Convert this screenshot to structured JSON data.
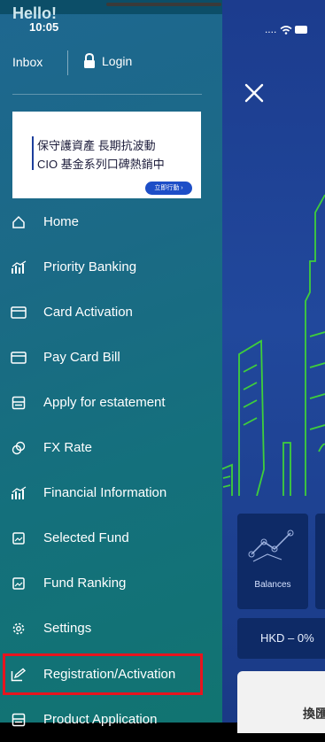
{
  "status": {
    "time": "10:05",
    "signal": "....",
    "wifi_icon": "wifi-icon",
    "battery_icon": "battery-icon"
  },
  "drawer": {
    "greeting": "Hello!",
    "inbox_label": "Inbox",
    "login_label": "Login",
    "ad": {
      "line1": "保守護資產 長期抗波動",
      "line2": "CIO 基金系列口碑熱銷中",
      "cta": "立即行動 ›"
    },
    "menu": [
      {
        "label": "Home",
        "icon": "home-icon"
      },
      {
        "label": "Priority Banking",
        "icon": "chart-icon"
      },
      {
        "label": "Card Activation",
        "icon": "card-icon"
      },
      {
        "label": "Pay Card Bill",
        "icon": "card-icon"
      },
      {
        "label": "Apply for estatement",
        "icon": "statement-icon"
      },
      {
        "label": "FX Rate",
        "icon": "fx-icon"
      },
      {
        "label": "Financial Information",
        "icon": "chart-icon"
      },
      {
        "label": "Selected Fund",
        "icon": "image-icon"
      },
      {
        "label": "Fund Ranking",
        "icon": "image-icon"
      },
      {
        "label": "Settings",
        "icon": "gear-icon"
      },
      {
        "label": "Registration/Activation",
        "icon": "edit-icon"
      },
      {
        "label": "Product Application",
        "icon": "statement-icon"
      }
    ]
  },
  "background": {
    "balances_label": "Balances",
    "fx_text": "HKD – 0%",
    "exchange_text": "換匯"
  },
  "colors": {
    "highlight": "#e8141e",
    "drawer_start": "#1e6790",
    "drawer_end": "#117471",
    "app_bg": "#21489c"
  }
}
